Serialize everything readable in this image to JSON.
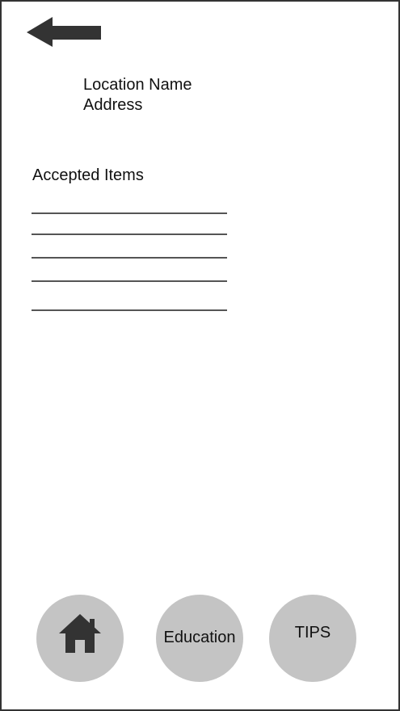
{
  "header": {
    "back_icon": "arrow-left-icon"
  },
  "location": {
    "name": "Location Name",
    "address": "Address"
  },
  "accepted_items": {
    "title": "Accepted Items",
    "items": [
      "",
      "",
      "",
      "",
      ""
    ]
  },
  "nav": {
    "home_icon": "home-icon",
    "education_label": "Education",
    "tips_label": "TIPS"
  },
  "colors": {
    "icon": "#333333",
    "nav_circle": "#c4c4c4",
    "line": "#555555"
  }
}
